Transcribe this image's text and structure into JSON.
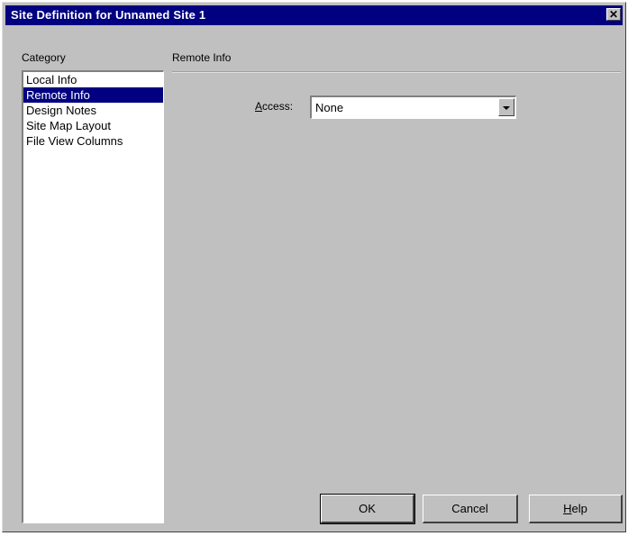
{
  "window": {
    "title": "Site Definition for Unnamed Site 1",
    "close_glyph": "✕"
  },
  "category": {
    "label": "Category",
    "items": [
      {
        "label": "Local Info",
        "selected": false
      },
      {
        "label": "Remote Info",
        "selected": true
      },
      {
        "label": "Design Notes",
        "selected": false
      },
      {
        "label": "Site Map Layout",
        "selected": false
      },
      {
        "label": "File View Columns",
        "selected": false
      }
    ]
  },
  "panel": {
    "title": "Remote Info",
    "access": {
      "label_prefix": "A",
      "label_rest": "ccess:",
      "value": "None"
    }
  },
  "buttons": {
    "ok": "OK",
    "cancel": "Cancel",
    "help_prefix": "H",
    "help_rest": "elp"
  }
}
